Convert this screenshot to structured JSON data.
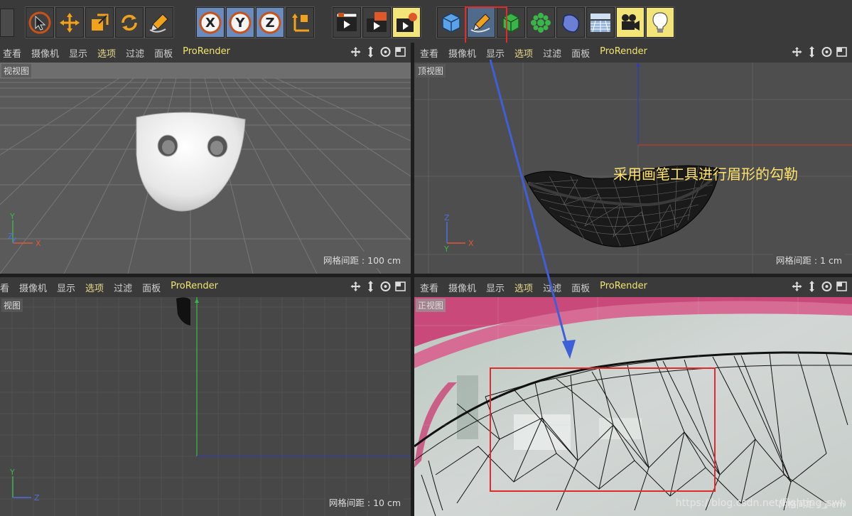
{
  "toolbar": {
    "groups": [
      {
        "icons": [
          "select-arrow-icon",
          "move-icon",
          "scale-icon",
          "rotate-icon",
          "pen-tool-icon"
        ]
      },
      {
        "icons": [
          "x-axis-lock-icon",
          "y-axis-lock-icon",
          "z-axis-lock-icon",
          "coordinate-system-icon"
        ]
      },
      {
        "icons": [
          "render-view-icon",
          "render-picture-viewer-icon",
          "render-settings-icon"
        ]
      },
      {
        "icons": [
          "cube-primitive-icon",
          "spline-pen-icon",
          "subdivision-icon",
          "mograph-cloner-icon",
          "deformer-icon",
          "floor-icon",
          "camera-icon",
          "light-icon"
        ]
      }
    ],
    "axis_labels": [
      "X",
      "Y",
      "Z"
    ]
  },
  "viewports": [
    {
      "menu": [
        "查看",
        "摄像机",
        "显示",
        "选项",
        "过滤",
        "面板",
        "ProRender"
      ],
      "active_item": "选项",
      "label": "视视图",
      "grid_spacing": "网格间距 : 100 cm",
      "axes": [
        "Y",
        "Z",
        "X"
      ]
    },
    {
      "menu": [
        "查看",
        "摄像机",
        "显示",
        "选项",
        "过滤",
        "面板",
        "ProRender"
      ],
      "active_item": "选项",
      "label": "顶视图",
      "grid_spacing": "网格间距 : 1 cm",
      "axes": [
        "Z",
        "Y",
        "X"
      ]
    },
    {
      "menu": [
        "看",
        "摄像机",
        "显示",
        "选项",
        "过滤",
        "面板",
        "ProRender"
      ],
      "active_item": "选项",
      "label": "视图",
      "grid_spacing": "网格间距 : 10 cm",
      "axes": [
        "Y",
        "Z"
      ]
    },
    {
      "menu": [
        "查看",
        "摄像机",
        "显示",
        "选项",
        "过滤",
        "面板",
        "ProRender"
      ],
      "active_item": "选项",
      "label": "正视图",
      "grid_spacing": "网格间距 : 1 cm"
    }
  ],
  "annotation": "采用画笔工具进行眉形的勾勒",
  "watermark": "https://blog.csdn.net/Fighting_swh",
  "colors": {
    "highlight_box": "#e02b2b",
    "annotation_text": "#ffe36a",
    "arrow": "#3f5fd8"
  }
}
